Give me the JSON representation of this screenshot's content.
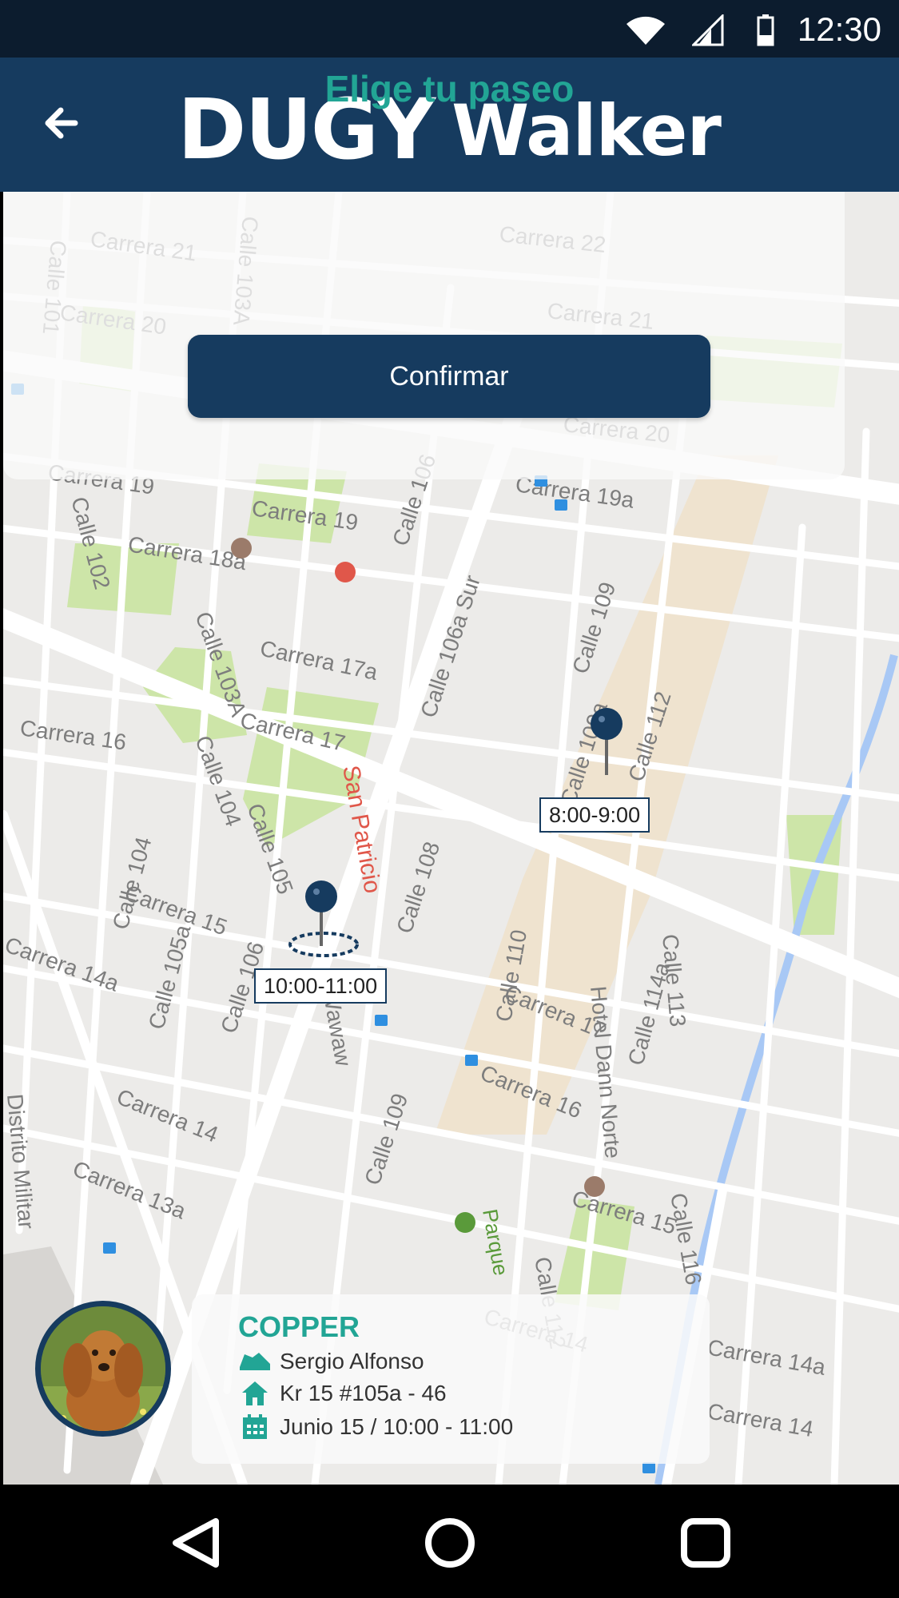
{
  "status_bar": {
    "time": "12:30",
    "icons": [
      "wifi-icon",
      "signal-icon",
      "battery-icon"
    ]
  },
  "app_bar": {
    "back_icon": "arrow-left-icon",
    "logo_part1": "DUGY",
    "logo_part2": "Walker"
  },
  "panel": {
    "title": "Elige tu paseo",
    "confirm_label": "Confirmar"
  },
  "map": {
    "pins": [
      {
        "label": "8:00-9:00",
        "selected": false
      },
      {
        "label": "10:00-11:00",
        "selected": true
      }
    ],
    "street_labels": [
      "Carrera 21",
      "Carrera 20",
      "Carrera 19",
      "Carrera 19a",
      "Carrera 18a",
      "Carrera 17a",
      "Carrera 17",
      "Carrera 16",
      "Carrera 15",
      "Carrera 14a",
      "Carrera 14",
      "Carrera 13a",
      "Carrera 22",
      "Calle 101",
      "Calle 102",
      "Calle 103A",
      "Calle 104",
      "Calle 105",
      "Calle 105a",
      "Calle 106",
      "Calle 106a Sur",
      "Calle 108",
      "Calle 109",
      "Calle 109a",
      "Calle 110",
      "Calle 112",
      "Calle 113",
      "Calle 114a",
      "Calle 116",
      "Carrera 14",
      "San Patricio",
      "Wawaw",
      "Hotel Dann Norte",
      "Distrito Militar",
      "Parque",
      "Carrera 14a"
    ]
  },
  "card": {
    "dog_name": "COPPER",
    "walker": "Sergio Alfonso",
    "address": "Kr 15 #105a - 46",
    "schedule": "Junio 15 / 10:00 - 11:00",
    "icons": [
      "shoe-icon",
      "home-icon",
      "calendar-icon"
    ]
  },
  "colors": {
    "primary": "#163b5f",
    "accent": "#22a595",
    "status_bar": "#0c1c2e"
  },
  "nav_bar": {
    "icons": [
      "back-triangle-icon",
      "home-circle-icon",
      "recents-square-icon"
    ]
  }
}
